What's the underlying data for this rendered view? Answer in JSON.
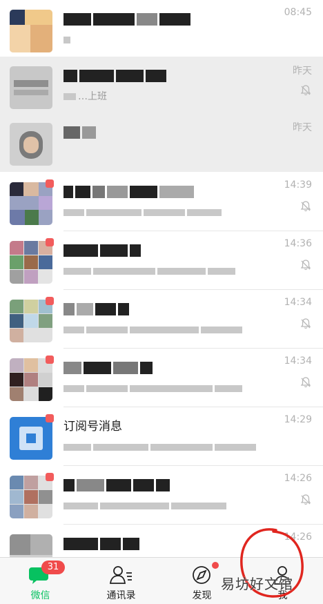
{
  "chats": [
    {
      "time": "08:45",
      "name_hint": "",
      "preview": "",
      "muted": false,
      "shaded": false,
      "unread_dot": false
    },
    {
      "time": "昨天",
      "name_hint": "",
      "preview": "…上班",
      "muted": true,
      "shaded": true,
      "unread_dot": false
    },
    {
      "time": "昨天",
      "name_hint": "",
      "preview": "",
      "muted": false,
      "shaded": true,
      "unread_dot": false
    },
    {
      "time": "14:39",
      "name_hint": "",
      "preview": "",
      "muted": true,
      "shaded": false,
      "unread_dot": true
    },
    {
      "time": "14:36",
      "name_hint": "",
      "preview": "",
      "muted": true,
      "shaded": false,
      "unread_dot": true
    },
    {
      "time": "14:34",
      "name_hint": "",
      "preview": "",
      "muted": true,
      "shaded": false,
      "unread_dot": true
    },
    {
      "time": "14:34",
      "name_hint": "",
      "preview": "",
      "muted": true,
      "shaded": false,
      "unread_dot": true
    },
    {
      "time": "14:29",
      "name_hint": "订阅号消息",
      "preview": "",
      "muted": false,
      "shaded": false,
      "unread_dot": true
    },
    {
      "time": "14:26",
      "name_hint": "",
      "preview": "",
      "muted": true,
      "shaded": false,
      "unread_dot": true
    },
    {
      "time": "14:26",
      "name_hint": "",
      "preview": "",
      "muted": false,
      "shaded": false,
      "unread_dot": false
    }
  ],
  "tabs": [
    {
      "label": "微信",
      "icon": "chat-bubble-icon",
      "badge": "31",
      "active": true
    },
    {
      "label": "通讯录",
      "icon": "contacts-icon",
      "badge": "",
      "active": false
    },
    {
      "label": "发现",
      "icon": "compass-icon",
      "badge": "",
      "active": false
    },
    {
      "label": "我",
      "icon": "person-icon",
      "badge": "",
      "active": false
    }
  ],
  "watermark": "易坊好文馆",
  "colors": {
    "accent": "#07c160",
    "badge": "#f04b4b",
    "annotation_circle": "#e0261f"
  }
}
